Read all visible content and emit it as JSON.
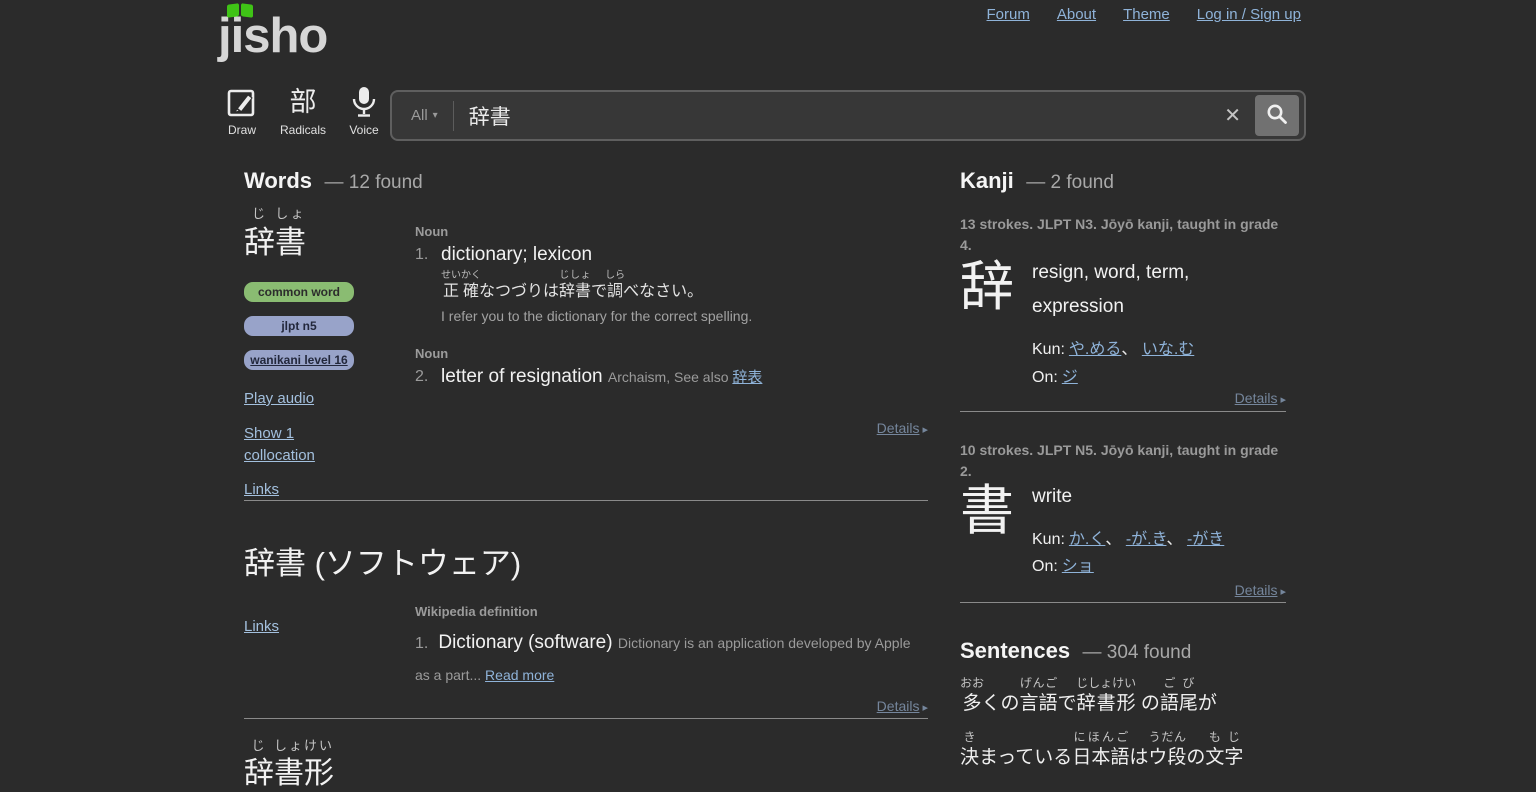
{
  "ui": {
    "details_arrow": "▸",
    "reading_separator": "、 ",
    "clear_glyph": "✕",
    "scope_caret": "▾"
  },
  "colors": {
    "background": "#2b2b2b",
    "link_blue": "#8fb3d9",
    "details_link": "#75869c",
    "tag_common_bg": "#8abc72",
    "tag_jlpt_bg": "#98a3c9",
    "logo_green": "#3fc316",
    "search_button_bg": "#717171"
  },
  "header": {
    "logo": "jisho",
    "nav": {
      "forum": "Forum",
      "about": "About",
      "theme": "Theme",
      "login": "Log in / Sign up"
    }
  },
  "search": {
    "scope": "All",
    "query": "辞書",
    "tools": {
      "draw": "Draw",
      "radicals": "Radicals",
      "radicals_glyph": "部",
      "voice": "Voice"
    }
  },
  "words": {
    "title": "Words",
    "count": "— 12 found",
    "entry1": {
      "reading": [
        {
          "t": "辞",
          "r": "じ"
        },
        {
          "t": "書",
          "r": "しょ"
        }
      ],
      "tags": {
        "common": "common word",
        "jlpt": "jlpt n5",
        "wanikani": "wanikani level 16"
      },
      "links": {
        "play_audio": "Play audio",
        "collocations": "Show 1 collocation",
        "links": "Links"
      },
      "sense1": {
        "pos": "Noun",
        "num": "1.",
        "gloss": "dictionary; lexicon",
        "example": [
          {
            "t": "正確",
            "r": "せいかく"
          },
          {
            "t": "なつづりは"
          },
          {
            "t": "辞書",
            "r": "じしょ"
          },
          {
            "t": "で"
          },
          {
            "t": "調",
            "r": "しら"
          },
          {
            "t": "べなさい。"
          }
        ],
        "translation": "I refer you to the dictionary for the correct spelling."
      },
      "sense2": {
        "pos": "Noun",
        "num": "2.",
        "gloss": "letter of resignation",
        "note": "Archaism, See also ",
        "see_also": "辞表"
      },
      "details": "Details"
    },
    "entry2": {
      "title": "辞書 (ソフトウェア)",
      "links_label": "Links",
      "source": "Wikipedia definition",
      "num": "1.",
      "gloss": "Dictionary (software)",
      "description": "Dictionary is an application developed by Apple as a part... ",
      "read_more": "Read more",
      "details": "Details"
    },
    "entry3_partial": {
      "reading": [
        {
          "t": "辞",
          "r": "じ"
        },
        {
          "t": "書",
          "r": "しょ"
        },
        {
          "t": "形",
          "r": "けい"
        }
      ]
    }
  },
  "kanji": {
    "title": "Kanji",
    "count": "— 2 found",
    "entry1": {
      "info": "13 strokes. JLPT N3. Jōyō kanji, taught in grade 4.",
      "character": "辞",
      "meanings": "resign, word, term, expression",
      "kun_label": "Kun:",
      "kun": [
        "や.める",
        "いな.む"
      ],
      "on_label": "On:",
      "on": [
        "ジ"
      ],
      "details": "Details"
    },
    "entry2": {
      "info": "10 strokes. JLPT N5. Jōyō kanji, taught in grade 2.",
      "character": "書",
      "meanings": "write",
      "kun_label": "Kun:",
      "kun": [
        "か.く",
        "-が.き",
        "-がき"
      ],
      "on_label": "On:",
      "on": [
        "ショ"
      ],
      "details": "Details"
    }
  },
  "sentences": {
    "title": "Sentences",
    "count": "— 304 found",
    "line1": [
      {
        "t": "多",
        "r": "おお"
      },
      {
        "t": "くの"
      },
      {
        "t": "言語",
        "r": "げんご"
      },
      {
        "t": "で"
      },
      {
        "t": "辞書形",
        "r": "じしょけい"
      },
      {
        "t": " の"
      },
      {
        "t": "語尾",
        "r": "ごび"
      },
      {
        "t": "が"
      }
    ],
    "line2": [
      {
        "t": "決",
        "r": "き"
      },
      {
        "t": "まっている"
      },
      {
        "t": "日本語",
        "r": "にほんご"
      },
      {
        "t": "は"
      },
      {
        "t": "ウ段",
        "r": "うだん"
      },
      {
        "t": "の"
      },
      {
        "t": "文字",
        "r": "もじ"
      }
    ]
  }
}
